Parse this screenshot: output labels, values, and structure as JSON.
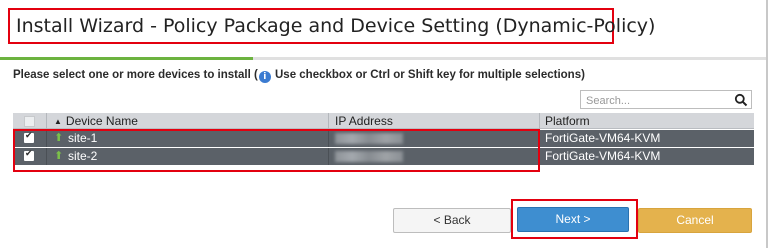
{
  "dialog": {
    "title": "Install Wizard - Policy Package and Device Setting (Dynamic-Policy)"
  },
  "progress": {
    "fraction": 0.33,
    "color": "#6cb33f"
  },
  "instruction": {
    "before_icon": "Please select one or more devices to install (",
    "icon": "info-icon",
    "after_icon": " Use checkbox or Ctrl or Shift key for multiple selections)"
  },
  "search": {
    "placeholder": "Search...",
    "value": ""
  },
  "table": {
    "columns": {
      "device_name": "Device Name",
      "ip_address": "IP Address",
      "platform": "Platform"
    },
    "sort_icon": "▲",
    "rows": [
      {
        "name": "site-1",
        "ip": "",
        "platform": "FortiGate-VM64-KVM",
        "checked": true
      },
      {
        "name": "site-2",
        "ip": "",
        "platform": "FortiGate-VM64-KVM",
        "checked": true
      }
    ]
  },
  "buttons": {
    "back": "< Back",
    "next": "Next >",
    "cancel": "Cancel"
  },
  "colors": {
    "highlight": "#e3000f",
    "selected_row": "#5b6168",
    "next_button": "#3e8ed0",
    "cancel_button": "#e4b24d",
    "online_arrow": "#7cc04a"
  }
}
